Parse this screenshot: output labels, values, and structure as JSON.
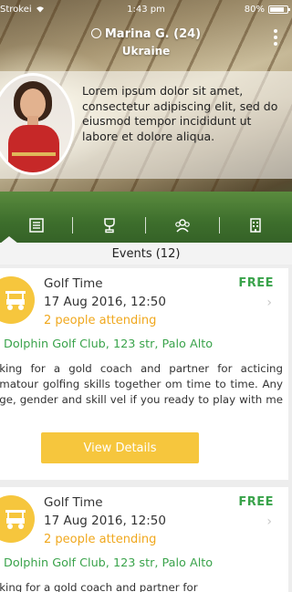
{
  "status_bar": {
    "carrier": "Strokei",
    "time": "1:43 pm",
    "battery": "80%"
  },
  "profile": {
    "name": "Marina G. (24)",
    "country": "Ukraine",
    "bio": "Lorem ipsum dolor sit amet, consectetur adipiscing elit, sed do eiusmod tempor incididunt ut labore et dolore aliqua."
  },
  "tabs": [
    {
      "icon": "list-icon"
    },
    {
      "icon": "trophy-icon"
    },
    {
      "icon": "group-icon"
    },
    {
      "icon": "building-icon"
    }
  ],
  "events_header": "Events (12)",
  "events": [
    {
      "title": "Golf Time",
      "date": "17 Aug 2016, 12:50",
      "attending": "2 people attending",
      "price": "FREE",
      "location": "Dolphin Golf Club, 123 str, Palo Alto",
      "description": "oking for a gold coach and partner for acticing amatour golfing skills together om time to time. Any age, gender and skill vel if you ready to play with me :)",
      "button": "View Details"
    },
    {
      "title": "Golf Time",
      "date": "17 Aug 2016, 12:50",
      "attending": "2 people attending",
      "price": "FREE",
      "location": "Dolphin Golf Club, 123 str, Palo Alto",
      "description": "oking for a gold coach and partner for"
    }
  ],
  "colors": {
    "accent_yellow": "#f6c63d",
    "accent_green": "#3aa34b",
    "attending_orange": "#f0a81e"
  }
}
